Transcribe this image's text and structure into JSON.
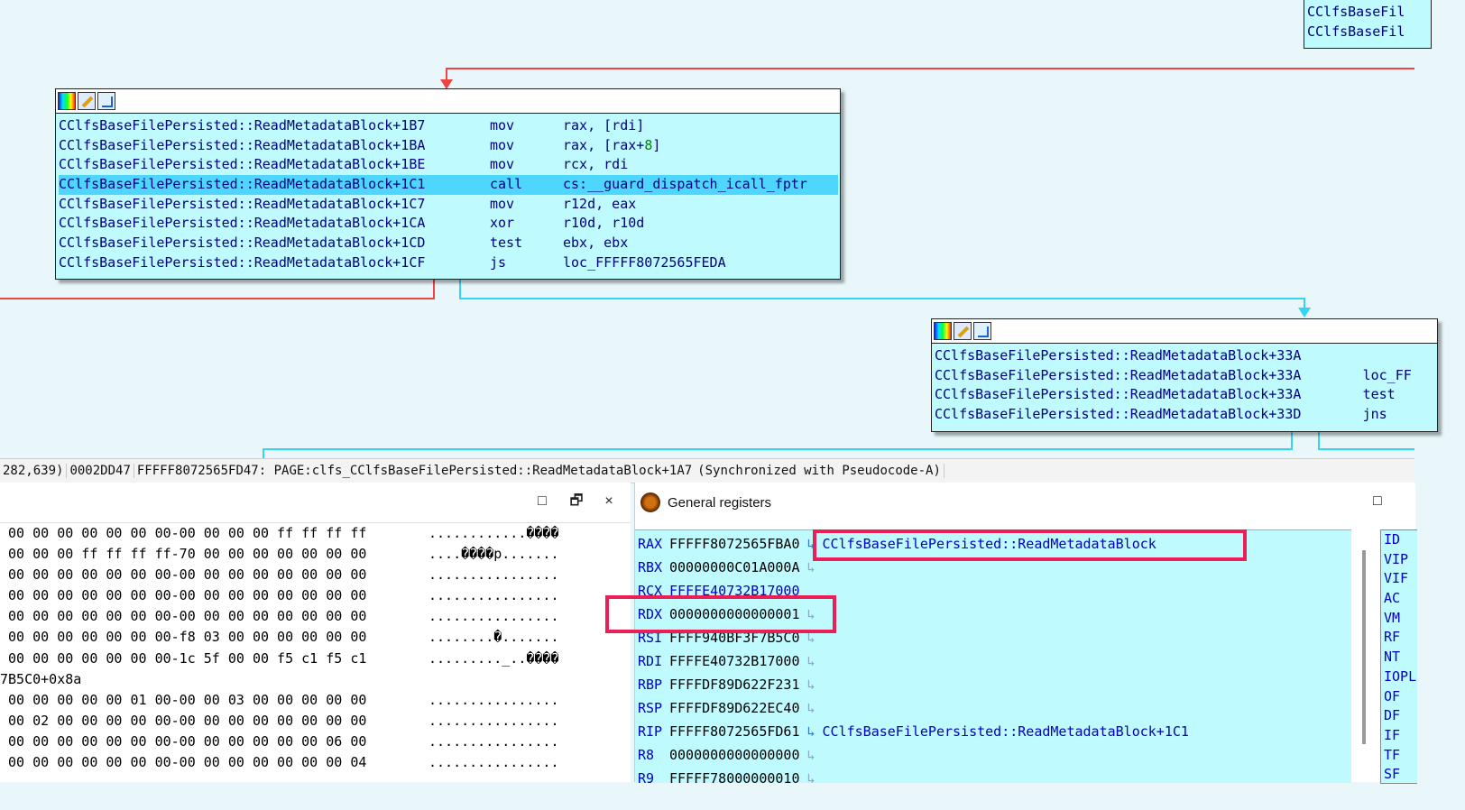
{
  "graph": {
    "top_block": {
      "rows": [
        "CClfsBaseFil",
        "CClfsBaseFil"
      ]
    },
    "main_block": {
      "rows": [
        {
          "addr": "CClfsBaseFilePersisted::ReadMetadataBlock+1B7",
          "mnemonic": "mov",
          "operand": "rax, [rdi]"
        },
        {
          "addr": "CClfsBaseFilePersisted::ReadMetadataBlock+1BA",
          "mnemonic": "mov",
          "operand": "rax, [rax+8]"
        },
        {
          "addr": "CClfsBaseFilePersisted::ReadMetadataBlock+1BE",
          "mnemonic": "mov",
          "operand": "rcx, rdi"
        },
        {
          "addr": "CClfsBaseFilePersisted::ReadMetadataBlock+1C1",
          "mnemonic": "call",
          "operand": "cs:__guard_dispatch_icall_fptr",
          "selected": true
        },
        {
          "addr": "CClfsBaseFilePersisted::ReadMetadataBlock+1C7",
          "mnemonic": "mov",
          "operand": "r12d, eax"
        },
        {
          "addr": "CClfsBaseFilePersisted::ReadMetadataBlock+1CA",
          "mnemonic": "xor",
          "operand": "r10d, r10d"
        },
        {
          "addr": "CClfsBaseFilePersisted::ReadMetadataBlock+1CD",
          "mnemonic": "test",
          "operand": "ebx, ebx"
        },
        {
          "addr": "CClfsBaseFilePersisted::ReadMetadataBlock+1CF",
          "mnemonic": "js",
          "operand": "loc_FFFFF8072565FEDA"
        }
      ]
    },
    "right_block": {
      "rows": [
        {
          "addr": "CClfsBaseFilePersisted::ReadMetadataBlock+33A",
          "mnemonic": ""
        },
        {
          "addr": "CClfsBaseFilePersisted::ReadMetadataBlock+33A",
          "mnemonic": "loc_FF"
        },
        {
          "addr": "CClfsBaseFilePersisted::ReadMetadataBlock+33A",
          "mnemonic": "test"
        },
        {
          "addr": "CClfsBaseFilePersisted::ReadMetadataBlock+33D",
          "mnemonic": "jns"
        }
      ]
    },
    "colors": {
      "edge_red": "#ee4444",
      "edge_cyan": "#33d6ee",
      "node_bg": "#bffaff",
      "selected_row": "#4fd6ff",
      "highlight_box": "#ea1f58"
    }
  },
  "statusbar": {
    "coords": "282,639)",
    "offset": "0002DD47",
    "location": "FFFFF8072565FD47: PAGE:clfs_CClfsBaseFilePersisted::ReadMetadataBlock+1A7",
    "sync": "(Synchronized with Pseudocode-A)"
  },
  "hex_panel": {
    "buttons": {
      "maximize": "□",
      "restore": "🗗",
      "close": "×"
    },
    "rows": [
      {
        "hex": " 00 00 00 00 00 00 00-00 00 00 00 ff ff ff ff",
        "ascii": "............����"
      },
      {
        "hex": " 00 00 00 ff ff ff ff-70 00 00 00 00 00 00 00",
        "ascii": "....����p......."
      },
      {
        "hex": " 00 00 00 00 00 00 00-00 00 00 00 00 00 00 00",
        "ascii": "................"
      },
      {
        "hex": " 00 00 00 00 00 00 00-00 00 00 00 00 00 00 00",
        "ascii": "................"
      },
      {
        "hex": " 00 00 00 00 00 00 00-00 00 00 00 00 00 00 00",
        "ascii": "................"
      },
      {
        "hex": " 00 00 00 00 00 00 00-f8 03 00 00 00 00 00 00",
        "ascii": "........�......."
      },
      {
        "hex": " 00 00 00 00 00 00 00-1c 5f 00 00 f5 c1 f5 c1",
        "ascii": "........._..����"
      },
      {
        "hex": "7B5C0+0x8a",
        "ascii": ""
      },
      {
        "hex": " 00 00 00 00 00 01 00-00 00 03 00 00 00 00 00",
        "ascii": "................"
      },
      {
        "hex": " 00 02 00 00 00 00 00-00 00 00 00 00 00 00 00",
        "ascii": "................"
      },
      {
        "hex": " 00 00 00 00 00 00 00-00 00 00 00 00 00 06 00",
        "ascii": "................"
      },
      {
        "hex": " 00 00 00 00 00 00 00-00 00 00 00 00 00 00 04",
        "ascii": "................"
      }
    ]
  },
  "registers": {
    "title": "General registers",
    "window_button": "□",
    "items": [
      {
        "name": "RAX",
        "value": "FFFFF8072565FBA0",
        "symbol": "CClfsBaseFilePersisted::ReadMetadataBlock"
      },
      {
        "name": "RBX",
        "value": "00000000C01A000A",
        "symbol": ""
      },
      {
        "name": "RCX",
        "value": "FFFFE40732B17000",
        "symbol": ""
      },
      {
        "name": "RDX",
        "value": "0000000000000001",
        "symbol": ""
      },
      {
        "name": "RSI",
        "value": "FFFF940BF3F7B5C0",
        "symbol": ""
      },
      {
        "name": "RDI",
        "value": "FFFFE40732B17000",
        "symbol": ""
      },
      {
        "name": "RBP",
        "value": "FFFFDF89D622F231",
        "symbol": ""
      },
      {
        "name": "RSP",
        "value": "FFFFDF89D622EC40",
        "symbol": ""
      },
      {
        "name": "RIP",
        "value": "FFFFF8072565FD61",
        "symbol": "CClfsBaseFilePersisted::ReadMetadataBlock+1C1"
      },
      {
        "name": "R8",
        "value": "0000000000000000",
        "symbol": ""
      },
      {
        "name": "R9",
        "value": "FFFFF78000000010",
        "symbol": ""
      }
    ],
    "flags": [
      "ID",
      "VIP",
      "VIF",
      "AC",
      "VM",
      "RF",
      "NT",
      "IOPL",
      "OF",
      "DF",
      "IF",
      "TF",
      "SF"
    ]
  }
}
